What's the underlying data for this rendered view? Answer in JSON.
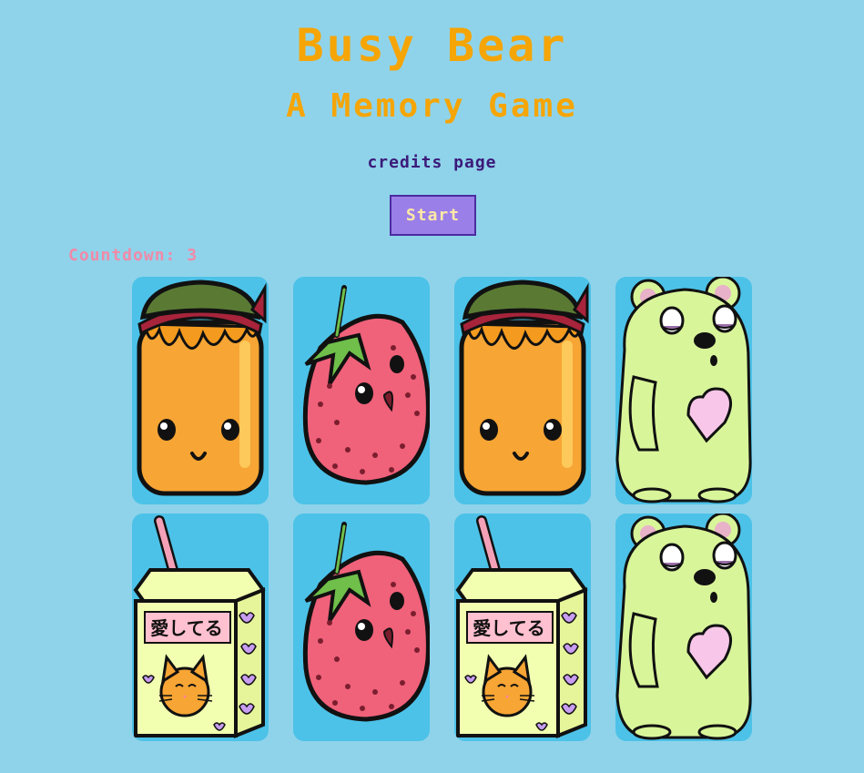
{
  "header": {
    "title": "Busy Bear",
    "subtitle": "A Memory Game",
    "credits_link": "credits page"
  },
  "controls": {
    "start_label": "Start",
    "countdown_label": "Countdown:",
    "countdown_value": "3",
    "countdown_text": "Countdown: 3"
  },
  "juicebox_text": "愛してる",
  "cards": [
    {
      "image": "honey-jar"
    },
    {
      "image": "strawberry"
    },
    {
      "image": "honey-jar"
    },
    {
      "image": "bear"
    },
    {
      "image": "juice-box"
    },
    {
      "image": "strawberry"
    },
    {
      "image": "juice-box"
    },
    {
      "image": "bear"
    }
  ],
  "colors": {
    "background": "#8fd3ea",
    "card_background": "#4cc2e8",
    "title": "#f5a506",
    "credits": "#3b1a7a",
    "start_button": "#9b7fe8",
    "countdown": "#f08aa8"
  }
}
